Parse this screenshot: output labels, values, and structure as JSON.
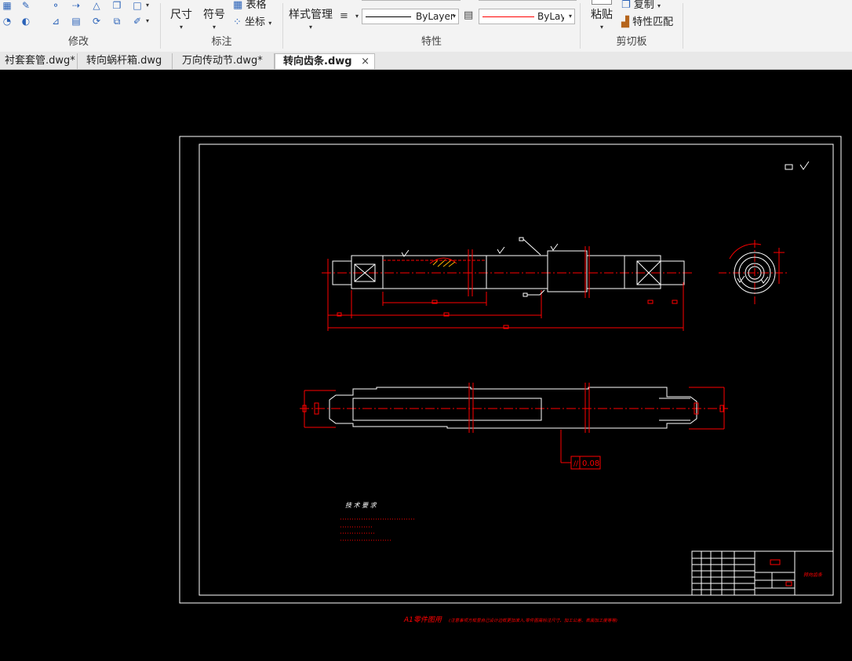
{
  "ribbon": {
    "modify": {
      "title": "修改"
    },
    "annotation": {
      "title": "标注",
      "dimension_label": "尺寸",
      "symbol_label": "符号",
      "table_label": "表格",
      "coordinate_label": "坐标"
    },
    "properties": {
      "title": "特性",
      "style_manager_label": "样式管理",
      "linetype_value": "ByLayer",
      "color_value": "ByLayer"
    },
    "clipboard": {
      "title": "剪切板",
      "paste_label": "粘贴",
      "copy_label": "复制",
      "match_properties_label": "特性匹配"
    }
  },
  "tabs": [
    {
      "label": "衬套套管.dwg*"
    },
    {
      "label": "转向蜗杆箱.dwg"
    },
    {
      "label": "万向传动节.dwg*"
    },
    {
      "label": "转向齿条.dwg",
      "active": true
    }
  ],
  "drawing": {
    "tolerance_value": "0.08",
    "tech_requirements_title": "技 术 要 求",
    "titleblock_part_name": "转向齿条",
    "bottom_note_main": "A1零件图用",
    "bottom_note_sub": "(注意事项方框里自己设计边框更加准入,零件图需标注尺寸、加工公差、表面加工度等等)"
  },
  "colors": {
    "ribbon_bg": "#f3f3f3",
    "canvas_bg": "#000000",
    "drawing_line": "#ffffff",
    "dimension": "#ff0000"
  }
}
